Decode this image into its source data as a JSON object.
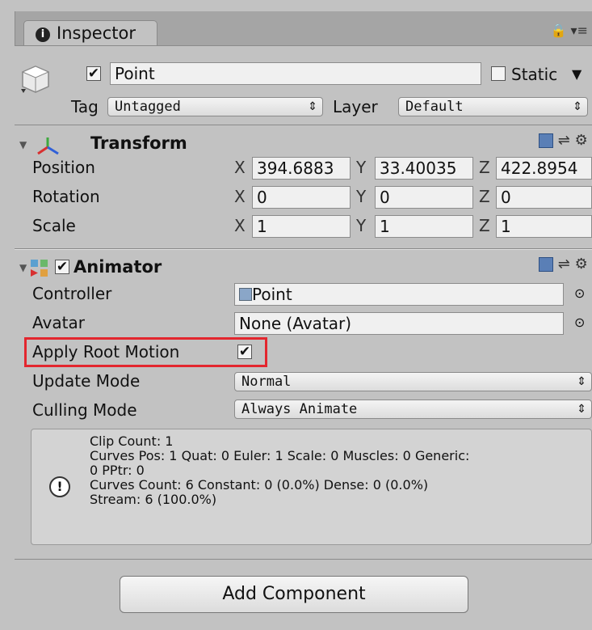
{
  "tab": {
    "icon": "info-icon",
    "title": "Inspector"
  },
  "object": {
    "active": true,
    "name": "Point",
    "static_label": "Static",
    "static_checked": false,
    "tag_label": "Tag",
    "tag_value": "Untagged",
    "layer_label": "Layer",
    "layer_value": "Default"
  },
  "transform": {
    "title": "Transform",
    "rows": [
      {
        "label": "Position",
        "x": "394.6883",
        "y": "33.40035",
        "z": "422.8954"
      },
      {
        "label": "Rotation",
        "x": "0",
        "y": "0",
        "z": "0"
      },
      {
        "label": "Scale",
        "x": "1",
        "y": "1",
        "z": "1"
      }
    ],
    "axis_x": "X",
    "axis_y": "Y",
    "axis_z": "Z"
  },
  "animator": {
    "title": "Animator",
    "enabled": true,
    "controller_label": "Controller",
    "controller_value": "Point",
    "avatar_label": "Avatar",
    "avatar_value": "None (Avatar)",
    "apply_root_label": "Apply Root Motion",
    "apply_root_checked": true,
    "update_label": "Update Mode",
    "update_value": "Normal",
    "culling_label": "Culling Mode",
    "culling_value": "Always Animate",
    "info": "Clip Count: 1\nCurves Pos: 1 Quat: 0 Euler: 1 Scale: 0 Muscles: 0 Generic:\n0 PPtr: 0\nCurves Count: 6 Constant: 0 (0.0%) Dense: 0 (0.0%)\nStream: 6 (100.0%)"
  },
  "add_component": "Add Component",
  "colors": {
    "highlight": "#e3262e",
    "panel": "#c2c2c2"
  }
}
